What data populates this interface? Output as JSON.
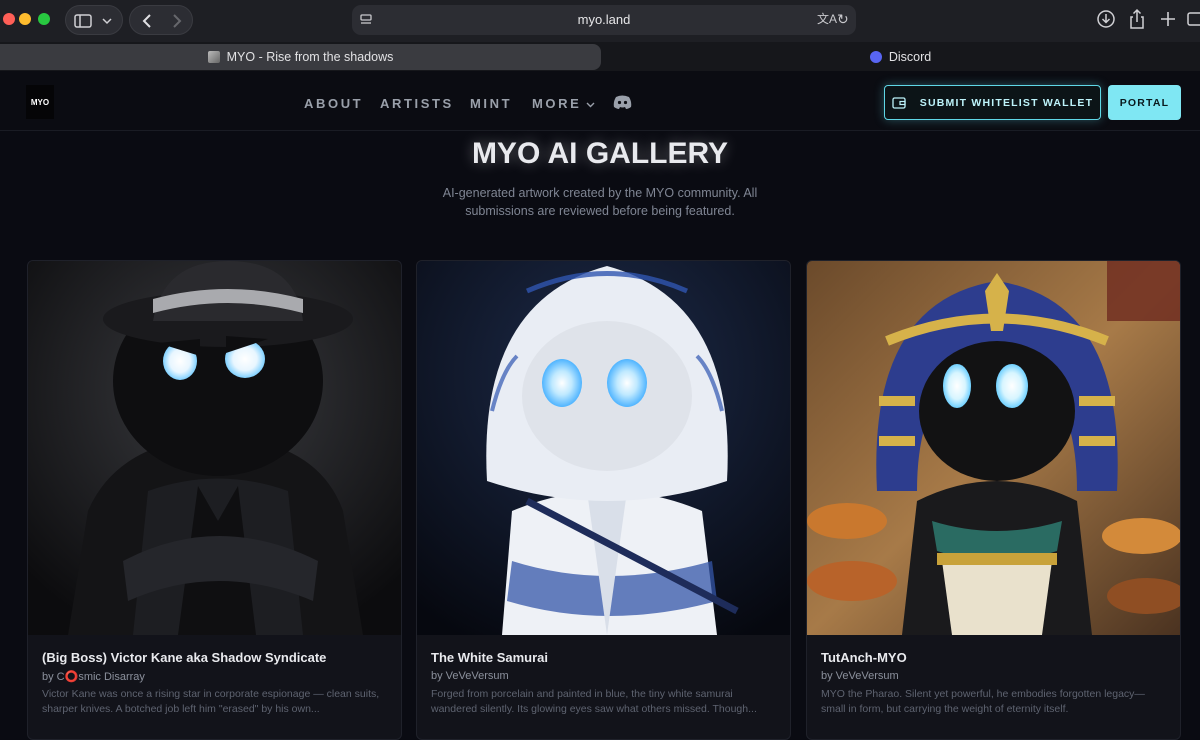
{
  "browser": {
    "url": "myo.land",
    "tabs": [
      {
        "label": "MYO - Rise from the shadows",
        "active": true
      },
      {
        "label": "Discord",
        "active": false
      }
    ]
  },
  "header": {
    "logo": "MYO",
    "nav": [
      "ABOUT",
      "ARTISTS",
      "MINT",
      "MORE"
    ],
    "whitelist_button": "SUBMIT WHITELIST WALLET",
    "portal_button": "PORTAL",
    "accent_color": "#7fe7f3"
  },
  "gallery": {
    "title": "MYO AI GALLERY",
    "description": "AI-generated artwork created by the MYO community. All submissions are reviewed before being featured."
  },
  "cards": [
    {
      "title": "(Big Boss) Victor Kane aka Shadow Syndicate",
      "author": "by C⭕smic Disarray",
      "description": "Victor Kane was once a rising star in corporate espionage — clean suits, sharper knives. A botched job left him \"erased\" by his own...",
      "art": "shadow-boss-fedora-artwork"
    },
    {
      "title": "The White Samurai",
      "author": "by VeVeVersum",
      "description": "Forged from porcelain and painted in blue, the tiny white samurai wandered silently. Its glowing eyes saw what others missed. Though...",
      "art": "porcelain-samurai-artwork"
    },
    {
      "title": "TutAnch-MYO",
      "author": "by VeVeVersum",
      "description": "MYO the Pharao. Silent yet powerful, he embodies forgotten legacy—small in form, but carrying the weight of eternity itself.",
      "art": "pharaoh-artwork"
    }
  ]
}
